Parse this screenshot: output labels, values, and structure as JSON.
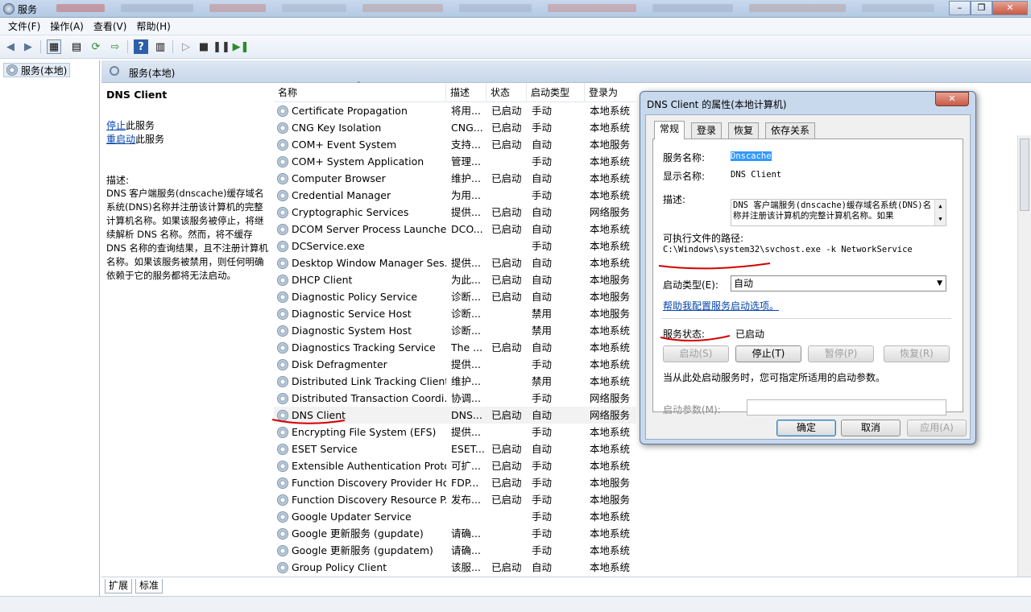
{
  "window": {
    "title": "服务"
  },
  "menu": [
    "文件(F)",
    "操作(A)",
    "查看(V)",
    "帮助(H)"
  ],
  "tree": {
    "root": "服务(本地)"
  },
  "main": {
    "header": "服务(本地)"
  },
  "desc_pane": {
    "service_name": "DNS Client",
    "stop_link": "停止",
    "stop_suffix": "此服务",
    "restart_link": "重启动",
    "restart_suffix": "此服务",
    "desc_label": "描述:",
    "desc_text": "DNS 客户端服务(dnscache)缓存域名系统(DNS)名称并注册该计算机的完整计算机名称。如果该服务被停止，将继续解析 DNS 名称。然而，将不缓存 DNS 名称的查询结果，且不注册计算机名称。如果该服务被禁用，则任何明确依赖于它的服务都将无法启动。"
  },
  "list": {
    "columns": [
      "名称",
      "描述",
      "状态",
      "启动类型",
      "登录为"
    ],
    "selected_index": 18,
    "rows": [
      {
        "name": "Certificate Propagation",
        "desc": "将用...",
        "status": "已启动",
        "startup": "手动",
        "logon": "本地系统"
      },
      {
        "name": "CNG Key Isolation",
        "desc": "CNG...",
        "status": "已启动",
        "startup": "手动",
        "logon": "本地系统"
      },
      {
        "name": "COM+ Event System",
        "desc": "支持...",
        "status": "已启动",
        "startup": "自动",
        "logon": "本地服务"
      },
      {
        "name": "COM+ System Application",
        "desc": "管理...",
        "status": "",
        "startup": "手动",
        "logon": "本地系统"
      },
      {
        "name": "Computer Browser",
        "desc": "维护...",
        "status": "已启动",
        "startup": "自动",
        "logon": "本地系统"
      },
      {
        "name": "Credential Manager",
        "desc": "为用...",
        "status": "",
        "startup": "手动",
        "logon": "本地系统"
      },
      {
        "name": "Cryptographic Services",
        "desc": "提供...",
        "status": "已启动",
        "startup": "自动",
        "logon": "网络服务"
      },
      {
        "name": "DCOM Server Process Launcher",
        "desc": "DCO...",
        "status": "已启动",
        "startup": "自动",
        "logon": "本地系统"
      },
      {
        "name": "DCService.exe",
        "desc": "",
        "status": "",
        "startup": "手动",
        "logon": "本地系统"
      },
      {
        "name": "Desktop Window Manager Ses...",
        "desc": "提供...",
        "status": "已启动",
        "startup": "自动",
        "logon": "本地系统"
      },
      {
        "name": "DHCP Client",
        "desc": "为此...",
        "status": "已启动",
        "startup": "自动",
        "logon": "本地服务"
      },
      {
        "name": "Diagnostic Policy Service",
        "desc": "诊断...",
        "status": "已启动",
        "startup": "自动",
        "logon": "本地服务"
      },
      {
        "name": "Diagnostic Service Host",
        "desc": "诊断...",
        "status": "",
        "startup": "禁用",
        "logon": "本地服务"
      },
      {
        "name": "Diagnostic System Host",
        "desc": "诊断...",
        "status": "",
        "startup": "禁用",
        "logon": "本地系统"
      },
      {
        "name": "Diagnostics Tracking Service",
        "desc": "The ...",
        "status": "已启动",
        "startup": "自动",
        "logon": "本地系统"
      },
      {
        "name": "Disk Defragmenter",
        "desc": "提供...",
        "status": "",
        "startup": "手动",
        "logon": "本地系统"
      },
      {
        "name": "Distributed Link Tracking Client",
        "desc": "维护...",
        "status": "",
        "startup": "禁用",
        "logon": "本地系统"
      },
      {
        "name": "Distributed Transaction Coordi...",
        "desc": "协调...",
        "status": "",
        "startup": "手动",
        "logon": "网络服务"
      },
      {
        "name": "DNS Client",
        "desc": "DNS...",
        "status": "已启动",
        "startup": "自动",
        "logon": "网络服务"
      },
      {
        "name": "Encrypting File System (EFS)",
        "desc": "提供...",
        "status": "",
        "startup": "手动",
        "logon": "本地系统"
      },
      {
        "name": "ESET Service",
        "desc": "ESET...",
        "status": "已启动",
        "startup": "自动",
        "logon": "本地系统"
      },
      {
        "name": "Extensible Authentication Proto...",
        "desc": "可扩...",
        "status": "已启动",
        "startup": "手动",
        "logon": "本地系统"
      },
      {
        "name": "Function Discovery Provider Host",
        "desc": "FDP...",
        "status": "已启动",
        "startup": "手动",
        "logon": "本地服务"
      },
      {
        "name": "Function Discovery Resource P...",
        "desc": "发布...",
        "status": "已启动",
        "startup": "手动",
        "logon": "本地服务"
      },
      {
        "name": "Google Updater Service",
        "desc": "",
        "status": "",
        "startup": "手动",
        "logon": "本地系统"
      },
      {
        "name": "Google 更新服务 (gupdate)",
        "desc": "请确...",
        "status": "",
        "startup": "手动",
        "logon": "本地系统"
      },
      {
        "name": "Google 更新服务 (gupdatem)",
        "desc": "请确...",
        "status": "",
        "startup": "手动",
        "logon": "本地系统"
      },
      {
        "name": "Group Policy Client",
        "desc": "该服...",
        "status": "已启动",
        "startup": "自动",
        "logon": "本地系统"
      }
    ]
  },
  "bottom_tabs": [
    "扩展",
    "标准"
  ],
  "dialog": {
    "title": "DNS Client 的属性(本地计算机)",
    "tabs": [
      "常规",
      "登录",
      "恢复",
      "依存关系"
    ],
    "service_name_label": "服务名称:",
    "service_name": "Dnscache",
    "display_name_label": "显示名称:",
    "display_name": "DNS Client",
    "desc_label": "描述:",
    "desc_text": "DNS 客户端服务(dnscache)缓存域名系统(DNS)名称并注册该计算机的完整计算机名称。如果",
    "path_label": "可执行文件的路径:",
    "path": "C:\\Windows\\system32\\svchost.exe -k NetworkService",
    "startup_label": "启动类型(E):",
    "startup_value": "自动",
    "help_link": "帮助我配置服务启动选项。",
    "status_label": "服务状态:",
    "status_value": "已启动",
    "btn_start": "启动(S)",
    "btn_stop": "停止(T)",
    "btn_pause": "暂停(P)",
    "btn_resume": "恢复(R)",
    "hint": "当从此处启动服务时，您可指定所适用的启动参数。",
    "params_label": "启动参数(M):",
    "ok": "确定",
    "cancel": "取消",
    "apply": "应用(A)"
  },
  "colors": {
    "annotation_red": "#d40000",
    "selection_blue": "#3399ff",
    "link_blue": "#0645ad"
  }
}
